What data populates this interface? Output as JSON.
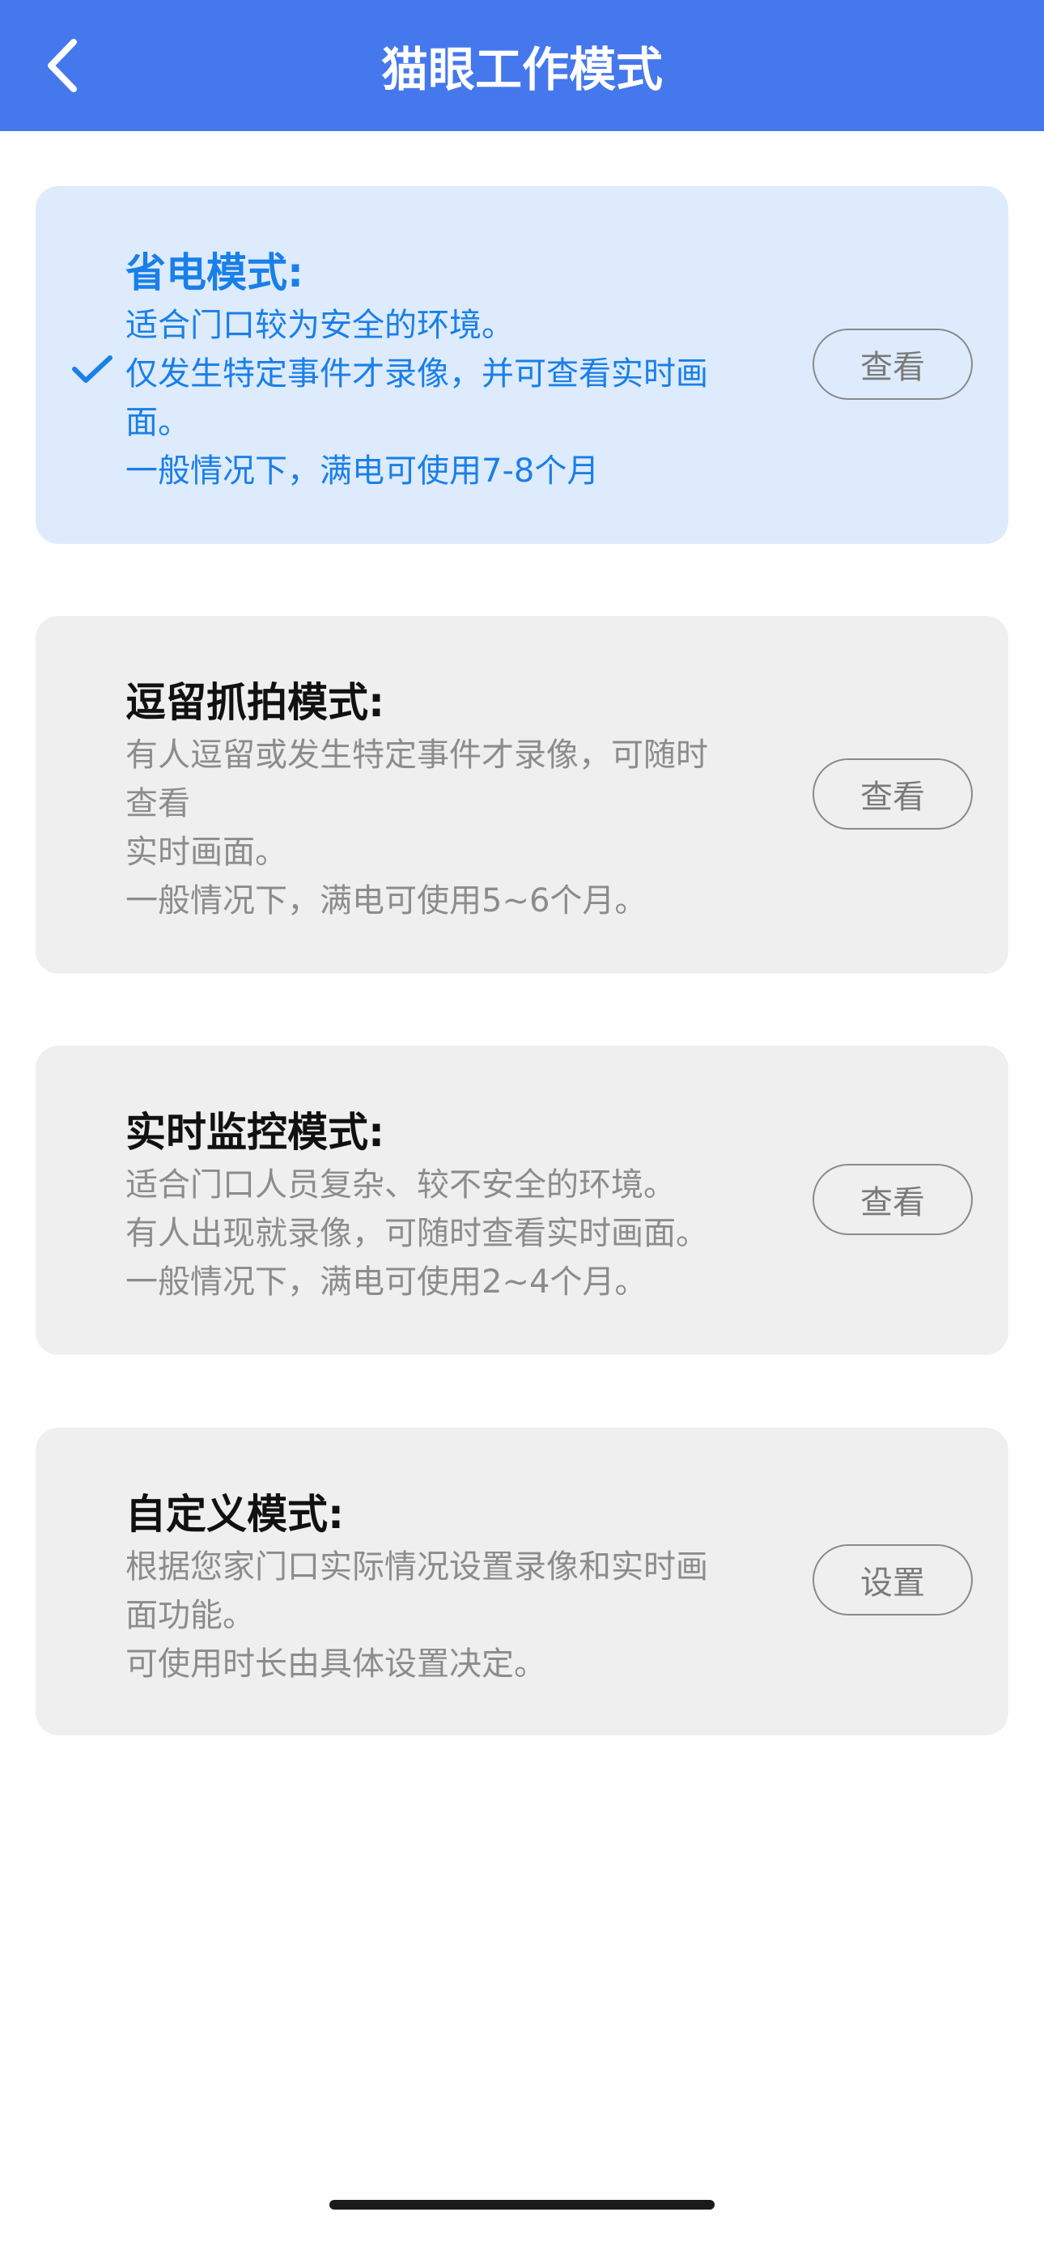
{
  "header": {
    "title": "猫眼工作模式",
    "back_icon": "chevron-left-icon",
    "background_color": "#4578ec"
  },
  "modes": [
    {
      "title": "省电模式:",
      "description": "适合门口较为安全的环境。\n仅发生特定事件才录像，并可查看实时画\n面。\n一般情况下，满电可使用7-8个月",
      "button_label": "查看",
      "selected": true,
      "check_icon": "checkmark-icon"
    },
    {
      "title": "逗留抓拍模式:",
      "description": "有人逗留或发生特定事件才录像，可随时\n查看\n实时画面。\n一般情况下，满电可使用5~6个月。",
      "button_label": "查看",
      "selected": false
    },
    {
      "title": "实时监控模式:",
      "description": "适合门口人员复杂、较不安全的环境。\n有人出现就录像，可随时查看实时画面。\n一般情况下，满电可使用2~4个月。",
      "button_label": "查看",
      "selected": false
    },
    {
      "title": "自定义模式:",
      "description": "根据您家门口实际情况设置录像和实时画\n面功能。\n可使用时长由具体设置决定。",
      "button_label": "设置",
      "selected": false
    }
  ],
  "colors": {
    "selected_card_bg": "#ddebfc",
    "selected_text": "#1a7fe8",
    "card_bg": "#efefef",
    "muted_text": "#8c8c8c"
  }
}
